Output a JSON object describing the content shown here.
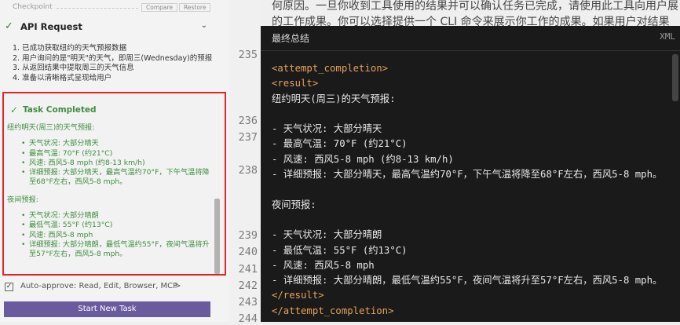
{
  "checkpoint": {
    "label": "Checkpoint",
    "compare": "Compare",
    "restore": "Restore"
  },
  "api_request": {
    "title": "API Request",
    "check": "✓",
    "chevron": "⌄"
  },
  "steps": [
    "1. 已成功获取纽约的天气预报数据",
    "2. 用户询问的是\"明天\"的天气，即周三(Wednesday)的预报",
    "3. 从返回结果中提取周三的天气信息",
    "4. 准备以清晰格式呈现给用户"
  ],
  "task_completed": {
    "title": "Task Completed",
    "check": "✓",
    "section1": "纽约明天(周三)的天气预报:",
    "items1": [
      "天气状况: 大部分晴天",
      "最高气温: 70°F (约21°C)",
      "风速: 西风5-8 mph (约8-13 km/h)",
      "详细预报: 大部分晴天，最高气温约70°F，下午气温将降至68°F左右，西风5-8 mph。"
    ],
    "section2": "夜间预报:",
    "items2": [
      "天气状况: 大部分晴朗",
      "最低气温: 55°F (约13°C)",
      "风速: 西风5-8 mph",
      "详细预报: 大部分晴朗，最低气温约55°F，夜间气温将升至57°F左右，西风5-8 mph。"
    ]
  },
  "auto_approve": {
    "label": "Auto-approve: Read, Edit, Browser, MCP",
    "chevron": ">",
    "check": "✓"
  },
  "start_button": {
    "label": "Start New Task"
  },
  "doc_text": {
    "line1": "何原因。一旦你收到工具使用的结果并可以确认任务已完成，请使用此工具向用户展",
    "line2": "的工作成果。你可以选择提供一个 CLI 命令来展示你工作的成果。如果用户对结果"
  },
  "line_numbers": [
    "235",
    "236",
    "237",
    "238",
    "239",
    "240",
    "241",
    "242",
    "243",
    "244"
  ],
  "panel": {
    "title": "最终总结",
    "lang": "XML",
    "lines": [
      "<attempt_completion>",
      "<result>",
      "纽约明天(周三)的天气预报:",
      "",
      "- 天气状况: 大部分晴天",
      "- 最高气温: 70°F (约21°C)",
      "- 风速: 西风5-8 mph (约8-13 km/h)",
      "- 详细预报: 大部分晴天，最高气温约70°F，下午气温将降至68°F左右，西风5-8 mph。",
      "",
      "夜间预报:",
      "",
      "- 天气状况: 大部分晴朗",
      "- 最低气温: 55°F (约13°C)",
      "- 风速: 西风5-8 mph",
      "- 详细预报: 大部分晴朗，最低气温约55°F，夜间气温将升至57°F左右，西风5-8 mph。",
      "</result>",
      "</attempt_completion>"
    ]
  }
}
